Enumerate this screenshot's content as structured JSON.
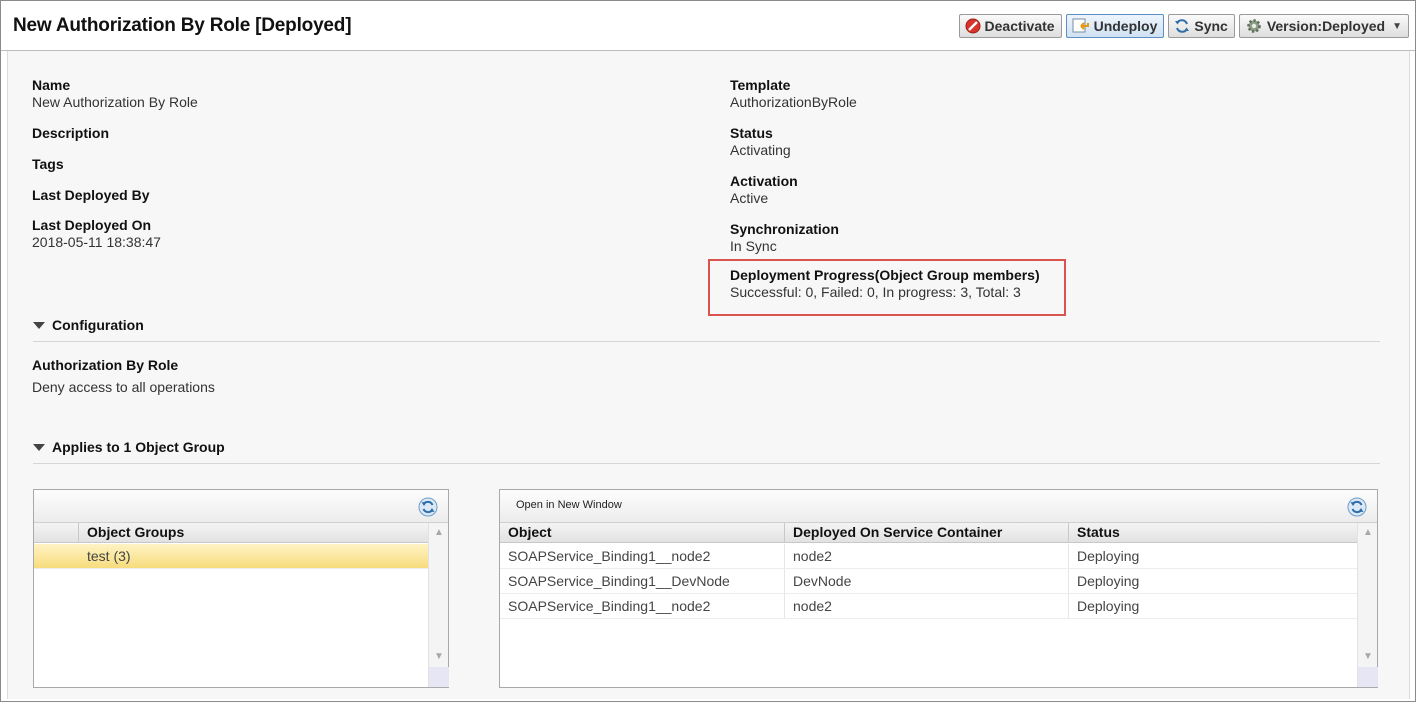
{
  "page_title": "New Authorization By Role [Deployed]",
  "toolbar": {
    "deactivate": "Deactivate",
    "undeploy": "Undeploy",
    "sync": "Sync",
    "version": "Version:Deployed"
  },
  "details_left": {
    "name_label": "Name",
    "name_value": "New Authorization By Role",
    "description_label": "Description",
    "tags_label": "Tags",
    "last_deployed_by_label": "Last Deployed By",
    "last_deployed_on_label": "Last Deployed On",
    "last_deployed_on_value": "2018-05-11 18:38:47"
  },
  "details_right": {
    "template_label": "Template",
    "template_value": "AuthorizationByRole",
    "status_label": "Status",
    "status_value": "Activating",
    "activation_label": "Activation",
    "activation_value": "Active",
    "synchronization_label": "Synchronization",
    "synchronization_value": "In Sync",
    "deployment_progress_label": "Deployment Progress(Object Group members)",
    "deployment_progress_value": "Successful: 0, Failed: 0, In progress: 3, Total: 3"
  },
  "configuration": {
    "section_title": "Configuration",
    "policy_label": "Authorization By Role",
    "policy_value": "Deny access to all operations"
  },
  "applies_to": {
    "section_title": "Applies to 1 Object Group",
    "groups_table": {
      "header": "Object Groups",
      "rows": [
        {
          "name": "test (3)"
        }
      ]
    },
    "objects_table": {
      "open_link": "Open in New Window",
      "headers": [
        "Object",
        "Deployed On Service Container",
        "Status"
      ],
      "rows": [
        [
          "SOAPService_Binding1__node2",
          "node2",
          "Deploying"
        ],
        [
          "SOAPService_Binding1__DevNode",
          "DevNode",
          "Deploying"
        ],
        [
          "SOAPService_Binding1__node2",
          "node2",
          "Deploying"
        ]
      ]
    }
  },
  "colors": {
    "highlight": "#d9534f",
    "selected_row": "#f7dc7c",
    "accent": "#5d8fc4"
  },
  "icons": [
    "deactivate-icon",
    "undeploy-icon",
    "sync-icon",
    "gear-icon",
    "dropdown-arrow-icon",
    "refresh-icon",
    "collapse-triangle-icon"
  ]
}
